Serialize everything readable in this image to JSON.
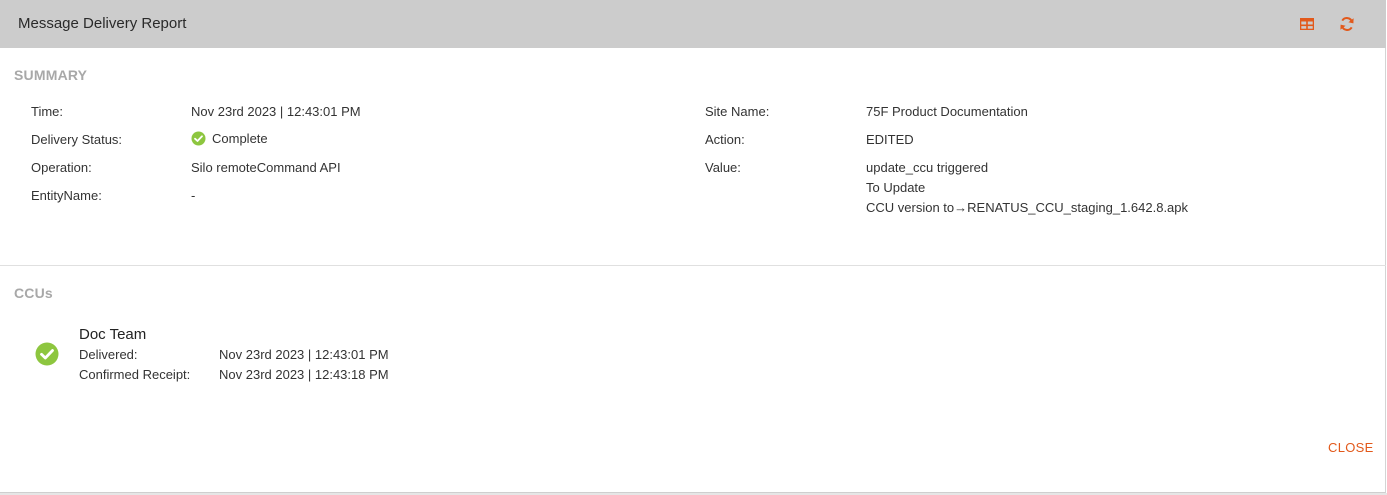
{
  "dialog": {
    "title": "Message Delivery Report",
    "icons": {
      "table": "table-icon",
      "refresh": "refresh-icon"
    },
    "accent_color": "#e2591b"
  },
  "summary": {
    "heading": "SUMMARY",
    "left": [
      {
        "label": "Time:",
        "value": "Nov 23rd 2023 | 12:43:01 PM"
      },
      {
        "label": "Delivery Status:",
        "value": "Complete"
      },
      {
        "label": "Operation:",
        "value": "Silo remoteCommand API"
      },
      {
        "label": "EntityName:",
        "value": "-"
      }
    ],
    "right": [
      {
        "label": "Site Name:",
        "value": "75F Product Documentation"
      },
      {
        "label": "Action:",
        "value": "EDITED"
      },
      {
        "label": "Value:",
        "lines": [
          "update_ccu triggered",
          "To Update",
          "CCU version to→RENATUS_CCU_staging_1.642.8.apk"
        ]
      }
    ],
    "status_color": "#8dc63f"
  },
  "ccus": {
    "heading": "CCUs",
    "items": [
      {
        "name": "Doc Team",
        "delivered_label": "Delivered:",
        "delivered_value": "Nov 23rd 2023 | 12:43:01 PM",
        "confirmed_label": "Confirmed Receipt:",
        "confirmed_value": "Nov 23rd 2023 | 12:43:18 PM"
      }
    ]
  },
  "footer": {
    "close_label": "CLOSE"
  }
}
